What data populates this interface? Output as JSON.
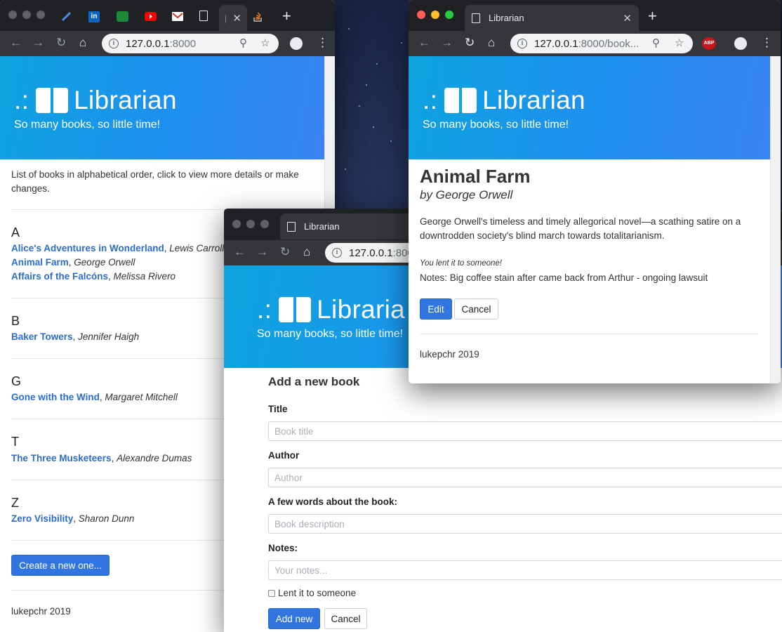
{
  "windows": {
    "list": {
      "url_host": "127.0.0.1",
      "url_port": ":8000",
      "page": {
        "brand_prefix": ".:",
        "brand_name": "Librarian",
        "tagline": "So many books, so little time!",
        "intro": "List of books in alphabetical order, click to view more details or make changes.",
        "sections": [
          {
            "letter": "A",
            "books": [
              {
                "title": "Alice's Adventures in Wonderland",
                "author": "Lewis Carroll"
              },
              {
                "title": "Animal Farm",
                "author": "George Orwell"
              },
              {
                "title": "Affairs of the Falcóns",
                "author": "Melissa Rivero"
              }
            ]
          },
          {
            "letter": "B",
            "books": [
              {
                "title": "Baker Towers",
                "author": "Jennifer Haigh"
              }
            ]
          },
          {
            "letter": "G",
            "books": [
              {
                "title": "Gone with the Wind",
                "author": "Margaret Mitchell"
              }
            ]
          },
          {
            "letter": "T",
            "books": [
              {
                "title": "The Three Musketeers",
                "author": "Alexandre Dumas"
              }
            ]
          },
          {
            "letter": "Z",
            "books": [
              {
                "title": "Zero Visibility",
                "author": "Sharon Dunn"
              }
            ]
          }
        ],
        "create_button": "Create a new one...",
        "footer": "lukepchr 2019"
      }
    },
    "form": {
      "tab_title": "Librarian",
      "url_host": "127.0.0.1",
      "url_port": ":800",
      "page": {
        "brand_prefix": ".:",
        "brand_name": "Libraria",
        "tagline": "So many books, so little time!",
        "heading": "Add a new book",
        "title_label": "Title",
        "title_placeholder": "Book title",
        "author_label": "Author",
        "author_placeholder": "Author",
        "desc_label": "A few words about the book:",
        "desc_placeholder": "Book description",
        "notes_label": "Notes:",
        "notes_placeholder": "Your notes...",
        "lent_label": "Lent it to someone",
        "add_button": "Add new",
        "cancel_button": "Cancel"
      }
    },
    "detail": {
      "tab_title": "Librarian",
      "url_host": "127.0.0.1",
      "url_rest": ":8000/book...",
      "adblock_label": "ABP",
      "page": {
        "brand_prefix": ".:",
        "brand_name": "Librarian",
        "tagline": "So many books, so little time!",
        "book_title": "Animal Farm",
        "book_author": "by George Orwell",
        "description": "George Orwell's timeless and timely allegorical novel—a scathing satire on a downtrodden society's blind march towards totalitarianism.",
        "lent_status": "You lent it to someone!",
        "notes": "Notes: Big coffee stain after came back from Arthur - ongoing lawsuit",
        "edit_button": "Edit",
        "cancel_button": "Cancel",
        "footer": "lukepchr 2019"
      }
    }
  },
  "colors": {
    "accent": "#3176e0",
    "link": "#2b6ccf",
    "hero_start": "#0da3e0",
    "hero_end": "#3b83f5",
    "chrome_dark": "#202124"
  }
}
